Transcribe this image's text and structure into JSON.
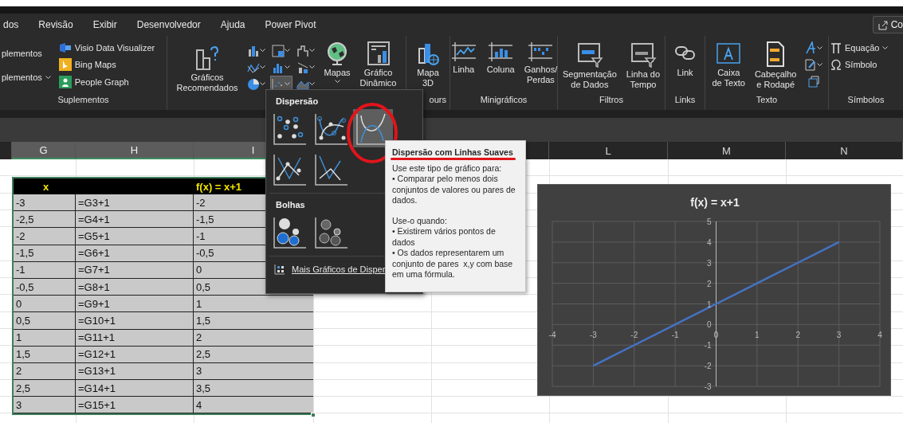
{
  "tabs": [
    "dos",
    "Revisão",
    "Exibir",
    "Desenvolvedor",
    "Ajuda",
    "Power Pivot"
  ],
  "share_button": "Co",
  "ribbon": {
    "addins": {
      "items": [
        "plementos",
        "plementos"
      ],
      "apps": [
        "Visio Data Visualizer",
        "Bing Maps",
        "People Graph"
      ],
      "label": "Suplementos"
    },
    "charts": {
      "recommended": "Gráficos\nRecomendados",
      "maps": "Mapas",
      "pivot": "Gráfico\nDinâmico",
      "scatter_menu_open": true
    },
    "tours": {
      "map3d": "Mapa\n3D",
      "label": "ours"
    },
    "sparklines": {
      "items": [
        "Linha",
        "Coluna",
        "Ganhos/\nPerdas"
      ],
      "label": "Minigráficos"
    },
    "filters": {
      "items": [
        "Segmentação\nde Dados",
        "Linha do\nTempo"
      ],
      "label": "Filtros"
    },
    "links": {
      "items": [
        "Link"
      ],
      "label": "Links"
    },
    "text": {
      "items": [
        "Caixa\nde Texto",
        "Cabeçalho\ne Rodapé"
      ],
      "label": "Texto"
    },
    "symbols": {
      "items": [
        "Equação",
        "Símbolo"
      ],
      "label": "Símbolos"
    }
  },
  "column_headers": [
    {
      "label": "G",
      "selected": true
    },
    {
      "label": "H",
      "selected": true
    },
    {
      "label": "I",
      "selected": true
    },
    {
      "label": "L",
      "selected": false
    },
    {
      "label": "M",
      "selected": false
    },
    {
      "label": "N",
      "selected": false
    }
  ],
  "table": {
    "headers": {
      "x": "x",
      "fx": "f(x) = x+1"
    },
    "rows": [
      [
        "-3",
        "=G3+1",
        "-2"
      ],
      [
        "-2,5",
        "=G4+1",
        "-1,5"
      ],
      [
        "-2",
        "=G5+1",
        "-1"
      ],
      [
        "-1,5",
        "=G6+1",
        "-0,5"
      ],
      [
        "-1",
        "=G7+1",
        "0"
      ],
      [
        "-0,5",
        "=G8+1",
        "0,5"
      ],
      [
        "0",
        "=G9+1",
        "1"
      ],
      [
        "0,5",
        "=G10+1",
        "1,5"
      ],
      [
        "1",
        "=G11+1",
        "2"
      ],
      [
        "1,5",
        "=G12+1",
        "2,5"
      ],
      [
        "2",
        "=G13+1",
        "3"
      ],
      [
        "2,5",
        "=G14+1",
        "3,5"
      ],
      [
        "3",
        "=G15+1",
        "4"
      ]
    ]
  },
  "chart": {
    "chart_data": {
      "type": "line",
      "title": "f(x) = x+1",
      "x": [
        -3,
        -2.5,
        -2,
        -1.5,
        -1,
        -0.5,
        0,
        0.5,
        1,
        1.5,
        2,
        2.5,
        3
      ],
      "grid": true,
      "series": [
        {
          "color": "#4472c4",
          "values": [
            -2,
            -1.5,
            -1,
            -0.5,
            0,
            0.5,
            1,
            1.5,
            2,
            2.5,
            3,
            3.5,
            4
          ]
        }
      ],
      "xlim": [
        -4,
        4
      ],
      "ylim": [
        -3,
        5
      ],
      "xticks": [
        -4,
        -3,
        -2,
        -1,
        0,
        1,
        2,
        3,
        4
      ],
      "yticks": [
        -3,
        -2,
        -1,
        0,
        1,
        2,
        3,
        4,
        5
      ]
    }
  },
  "scatter_menu": {
    "sections": [
      {
        "title": "Dispersão",
        "options": [
          {
            "kind": "markers",
            "selected": false
          },
          {
            "kind": "smooth-markers",
            "selected": false
          },
          {
            "kind": "smooth",
            "selected": true
          },
          {
            "kind": "straight-markers",
            "selected": false
          },
          {
            "kind": "straight",
            "selected": false
          }
        ]
      },
      {
        "title": "Bolhas",
        "options": [
          {
            "kind": "bubble",
            "selected": false
          },
          {
            "kind": "bubble-3d",
            "selected": false
          }
        ]
      }
    ],
    "more_link": "Mais Gráficos de Disper"
  },
  "tooltip": {
    "title": "Dispersão com Linhas Suaves",
    "paragraphs": [
      "Use este tipo de gráfico para:",
      "• Comparar pelo menos dois conjuntos de valores ou pares de dados.",
      "Use-o quando:",
      "• Existirem vários pontos de dados",
      "• Os dados representarem um conjunto de pares  x,y com base em uma fórmula."
    ]
  }
}
